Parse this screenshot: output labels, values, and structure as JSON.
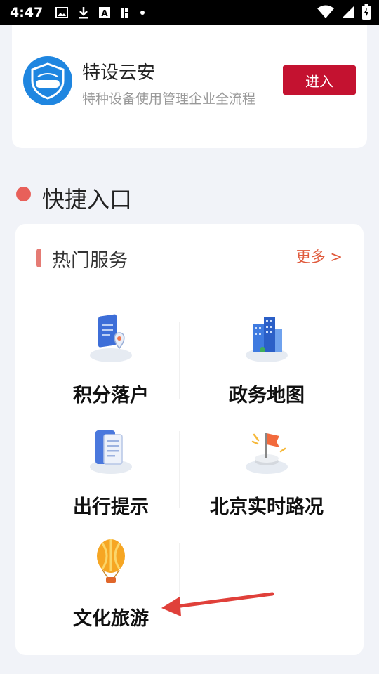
{
  "status_bar": {
    "time": "4:47",
    "left_icons": [
      "image-icon",
      "download-icon",
      "a-icon",
      "k-icon",
      "dot-icon"
    ],
    "right_icons": [
      "wifi-icon",
      "signal-icon",
      "battery-icon"
    ]
  },
  "app": {
    "title": "特设云安",
    "subtitle": "特种设备使用管理企业全流程",
    "logo_text": "特设云安",
    "enter_label": "进入"
  },
  "section": {
    "title": "快捷入口"
  },
  "hot_services": {
    "title": "热门服务",
    "more_label": "更多 >",
    "items": [
      {
        "label": "积分落户",
        "icon": "document-pin-icon"
      },
      {
        "label": "政务地图",
        "icon": "buildings-icon"
      },
      {
        "label": "出行提示",
        "icon": "notebook-icon"
      },
      {
        "label": "北京实时路况",
        "icon": "flag-icon"
      },
      {
        "label": "文化旅游",
        "icon": "balloon-icon"
      }
    ]
  },
  "colors": {
    "accent_red": "#c41230",
    "more_link": "#e05a3c",
    "dot": "#e8605a",
    "annotation_arrow": "#e0403a"
  }
}
